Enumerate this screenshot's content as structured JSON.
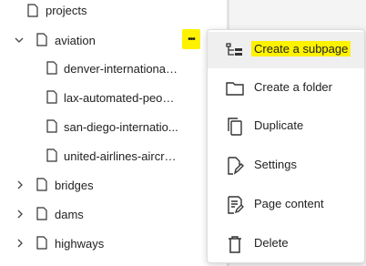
{
  "tree": {
    "items": [
      {
        "label": "projects",
        "icon": "page-icon",
        "expanded": true
      },
      {
        "label": "aviation",
        "icon": "page-icon",
        "expanded": true
      },
      {
        "label": "denver-international-...",
        "icon": "page-icon"
      },
      {
        "label": "lax-automated-peopl...",
        "icon": "page-icon"
      },
      {
        "label": "san-diego-internatio...",
        "icon": "page-icon"
      },
      {
        "label": "united-airlines-aircra...",
        "icon": "page-icon"
      },
      {
        "label": "bridges",
        "icon": "page-icon",
        "expanded": false
      },
      {
        "label": "dams",
        "icon": "page-icon",
        "expanded": false
      },
      {
        "label": "highways",
        "icon": "page-icon",
        "expanded": false
      }
    ],
    "more_button": {
      "label": "•••",
      "icon": "more-horizontal-icon"
    }
  },
  "context_menu": {
    "items": [
      {
        "label": "Create a subpage",
        "icon": "create-subpage-icon"
      },
      {
        "label": "Create a folder",
        "icon": "folder-icon"
      },
      {
        "label": "Duplicate",
        "icon": "duplicate-icon"
      },
      {
        "label": "Settings",
        "icon": "settings-icon"
      },
      {
        "label": "Page content",
        "icon": "page-content-icon"
      },
      {
        "label": "Delete",
        "icon": "trash-icon"
      }
    ]
  },
  "colors": {
    "highlight": "#fff200",
    "menu_hover": "#efefef",
    "text": "#222222"
  }
}
